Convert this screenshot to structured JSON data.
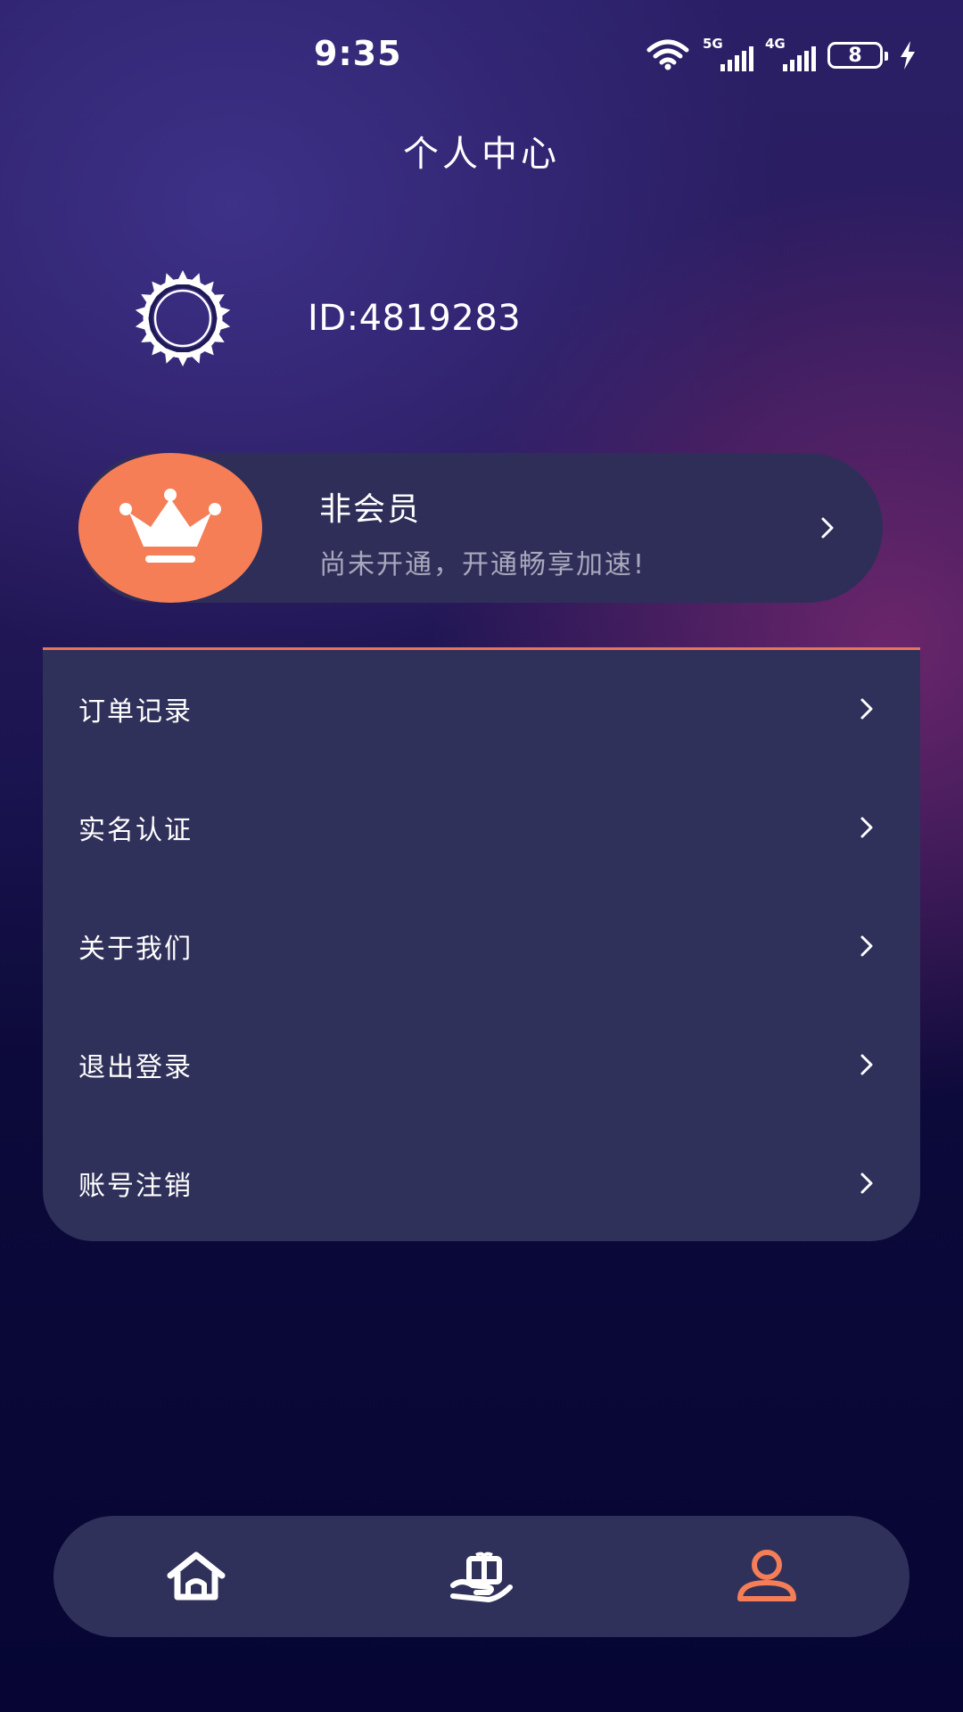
{
  "status_bar": {
    "time": "9:35",
    "signal_1_label": "5G",
    "signal_2_label": "4G",
    "battery_level": "8",
    "icons": [
      "wifi-icon",
      "signal-icon",
      "signal-icon",
      "battery-icon",
      "charging-icon"
    ]
  },
  "header": {
    "title": "个人中心"
  },
  "profile": {
    "id_text": "ID:4819283",
    "avatar_icon": "sunburst-avatar-icon"
  },
  "membership": {
    "title": "非会员",
    "description": "尚未开通，开通畅享加速!",
    "icon": "crown-icon",
    "badge_color": "#f57e57"
  },
  "menu": {
    "items": [
      {
        "label": "订单记录"
      },
      {
        "label": "实名认证"
      },
      {
        "label": "关于我们"
      },
      {
        "label": "退出登录"
      },
      {
        "label": "账号注销"
      }
    ]
  },
  "bottom_nav": {
    "items": [
      {
        "icon": "home-icon",
        "active": false
      },
      {
        "icon": "gift-hand-icon",
        "active": false
      },
      {
        "icon": "user-icon",
        "active": true
      }
    ],
    "active_color": "#f57e57",
    "inactive_color": "#ffffff"
  },
  "colors": {
    "panel": "#30315a",
    "accent": "#e9745a"
  }
}
